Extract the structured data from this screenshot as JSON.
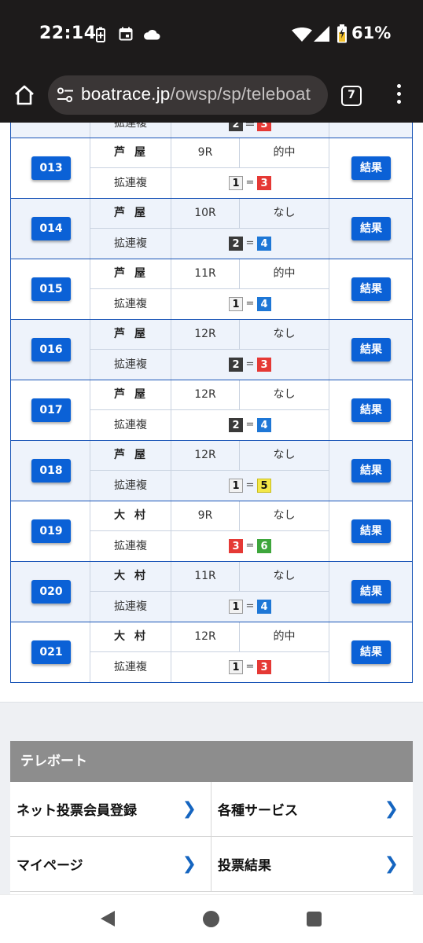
{
  "status_bar": {
    "time": "22:14",
    "battery": "61%"
  },
  "browser": {
    "url_host": "boatrace.jp",
    "url_path": "/owsp/sp/teleboat",
    "tab_count": "7"
  },
  "table": {
    "partial_row": {
      "combo": [
        2,
        3
      ]
    },
    "rows": [
      {
        "no": "013",
        "place": "芦屋",
        "race": "9R",
        "hit": "的中",
        "type": "拡連複",
        "combo": [
          1,
          3
        ],
        "result": "結果"
      },
      {
        "no": "014",
        "place": "芦屋",
        "race": "10R",
        "hit": "なし",
        "type": "拡連複",
        "combo": [
          2,
          4
        ],
        "result": "結果"
      },
      {
        "no": "015",
        "place": "芦屋",
        "race": "11R",
        "hit": "的中",
        "type": "拡連複",
        "combo": [
          1,
          4
        ],
        "result": "結果"
      },
      {
        "no": "016",
        "place": "芦屋",
        "race": "12R",
        "hit": "なし",
        "type": "拡連複",
        "combo": [
          2,
          3
        ],
        "result": "結果"
      },
      {
        "no": "017",
        "place": "芦屋",
        "race": "12R",
        "hit": "なし",
        "type": "拡連複",
        "combo": [
          2,
          4
        ],
        "result": "結果"
      },
      {
        "no": "018",
        "place": "芦屋",
        "race": "12R",
        "hit": "なし",
        "type": "拡連複",
        "combo": [
          1,
          5
        ],
        "result": "結果"
      },
      {
        "no": "019",
        "place": "大村",
        "race": "9R",
        "hit": "なし",
        "type": "拡連複",
        "combo": [
          3,
          6
        ],
        "result": "結果"
      },
      {
        "no": "020",
        "place": "大村",
        "race": "11R",
        "hit": "なし",
        "type": "拡連複",
        "combo": [
          1,
          4
        ],
        "result": "結果"
      },
      {
        "no": "021",
        "place": "大村",
        "race": "12R",
        "hit": "的中",
        "type": "拡連複",
        "combo": [
          1,
          3
        ],
        "result": "結果"
      }
    ]
  },
  "teleboat": {
    "heading": "テレボート",
    "items": [
      {
        "label": "ネット投票会員登録"
      },
      {
        "label": "各種サービス"
      },
      {
        "label": "マイページ"
      },
      {
        "label": "投票結果"
      }
    ]
  },
  "colors": {
    "accent": "#0b61d6",
    "border": "#1a55b7",
    "row_shade": "#eef3fb"
  }
}
